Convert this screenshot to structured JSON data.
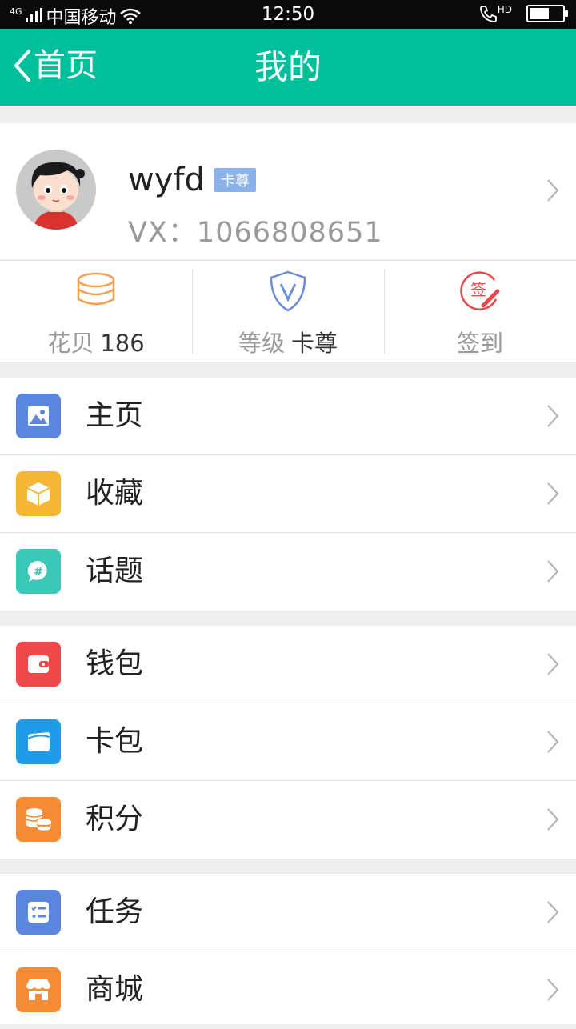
{
  "status_bar": {
    "network": "4G",
    "carrier": "中国移动",
    "time": "12:50",
    "hd": "HD",
    "battery_level": 0.6
  },
  "nav": {
    "back_label": "首页",
    "title": "我的"
  },
  "profile": {
    "username": "wyfd",
    "badge": "卡尊",
    "vx": "VX：1066808651"
  },
  "stats": [
    {
      "label": "花贝",
      "value": "186",
      "icon": "coin-stack-icon",
      "color": "#f0a050"
    },
    {
      "label": "等级",
      "value": "卡尊",
      "icon": "shield-v-icon",
      "color": "#6b8fd6"
    },
    {
      "label": "签到",
      "value": "",
      "icon": "sign-in-icon",
      "color": "#e8494b"
    }
  ],
  "menu_groups": [
    [
      {
        "label": "主页",
        "icon": "image-icon",
        "color": "#5b86de"
      },
      {
        "label": "收藏",
        "icon": "box-icon",
        "color": "#f5b636"
      },
      {
        "label": "话题",
        "icon": "chat-hash-icon",
        "color": "#3ac8b9"
      }
    ],
    [
      {
        "label": "钱包",
        "icon": "wallet-icon",
        "color": "#f0474a"
      },
      {
        "label": "卡包",
        "icon": "card-icon",
        "color": "#1f9be8"
      },
      {
        "label": "积分",
        "icon": "coins-icon",
        "color": "#f68b35"
      }
    ],
    [
      {
        "label": "任务",
        "icon": "checklist-icon",
        "color": "#5b86de"
      },
      {
        "label": "商城",
        "icon": "store-icon",
        "color": "#f68b35"
      }
    ]
  ]
}
